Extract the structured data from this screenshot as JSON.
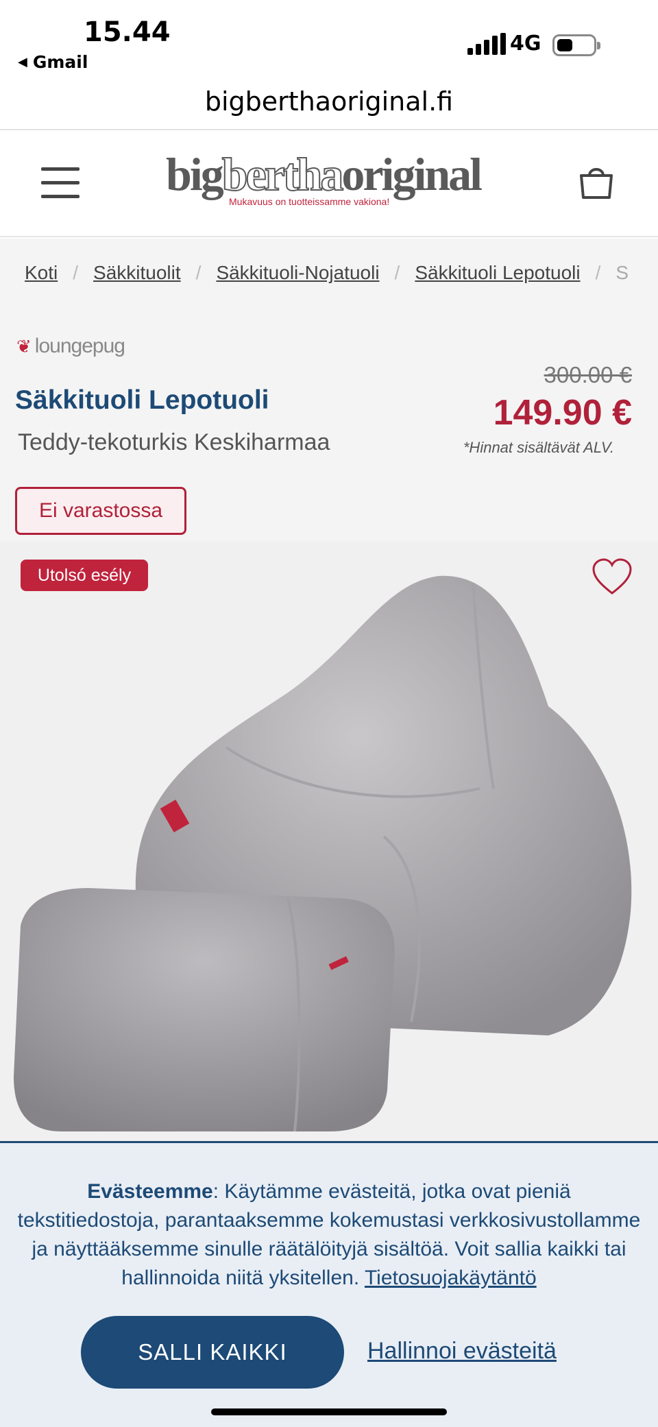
{
  "status_bar": {
    "time": "15.44",
    "back_app": "Gmail",
    "network": "4G"
  },
  "browser": {
    "url": "bigberthaoriginal.fi"
  },
  "header": {
    "logo_parts": [
      "big",
      "bertha",
      "original"
    ],
    "logo_tagline": "Mukavuus on tuotteissamme vakiona!"
  },
  "breadcrumbs": [
    "Koti",
    "Säkkituolit",
    "Säkkituoli-Nojatuoli",
    "Säkkituoli Lepotuoli",
    "S"
  ],
  "product": {
    "brand": "loungepug",
    "title": "Säkkituoli Lepotuoli",
    "subtitle": "Teddy-tekoturkis Keskiharmaa",
    "old_price": "300.00 €",
    "price": "149.90 €",
    "vat_note": "*Hinnat sisältävät ALV.",
    "stock_status": "Ei varastossa",
    "promo_badge": "Utolsó esély"
  },
  "cookie_banner": {
    "heading": "Evästeemme",
    "text": ": Käytämme evästeitä, jotka ovat pieniä tekstitiedostoja, parantaaksemme kokemustasi verkkosivustollamme ja näyttääksemme sinulle räätälöityjä sisältöä. Voit sallia kaikki tai hallinnoida niitä yksitellen. ",
    "privacy_link": "Tietosuojakäytäntö",
    "allow_all": "SALLI KAIKKI",
    "manage": "Hallinnoi evästeitä"
  },
  "colors": {
    "brand_blue": "#1d4a76",
    "brand_red": "#b0213a"
  }
}
